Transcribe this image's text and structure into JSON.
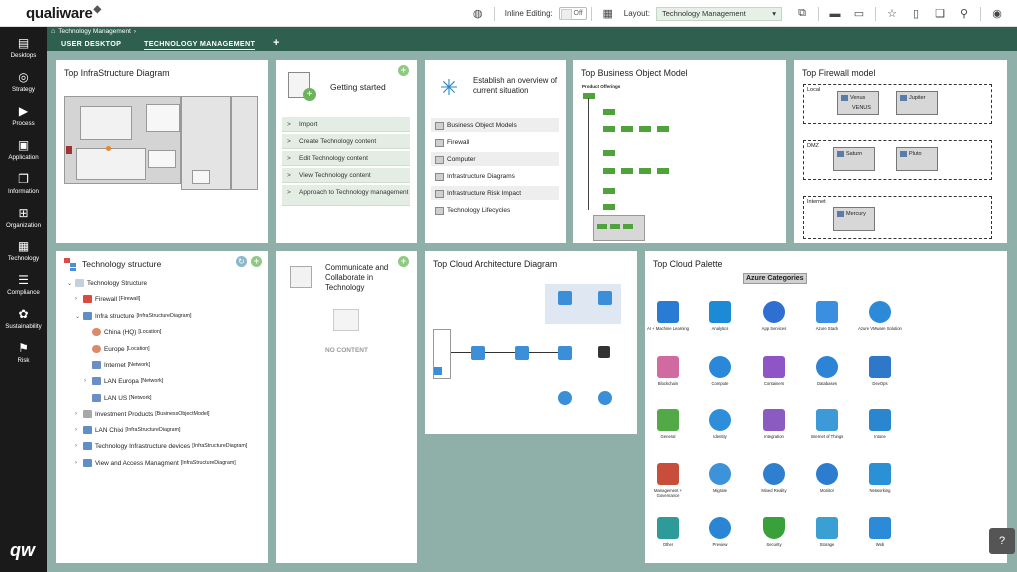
{
  "header": {
    "logo": "qualiware",
    "inline_editing_label": "Inline Editing:",
    "inline_editing_state": "Off",
    "layout_label": "Layout:",
    "layout_value": "Technology Management"
  },
  "sidebar": {
    "items": [
      {
        "label": "Desktops",
        "icon": "desktops-icon",
        "glyph": "▤"
      },
      {
        "label": "Strategy",
        "icon": "strategy-icon",
        "glyph": "◎"
      },
      {
        "label": "Process",
        "icon": "process-icon",
        "glyph": "▶"
      },
      {
        "label": "Application",
        "icon": "application-icon",
        "glyph": "▣"
      },
      {
        "label": "Information",
        "icon": "information-icon",
        "glyph": "❐"
      },
      {
        "label": "Organization",
        "icon": "organization-icon",
        "glyph": "⊞"
      },
      {
        "label": "Technology",
        "icon": "technology-icon",
        "glyph": "▦"
      },
      {
        "label": "Compliance",
        "icon": "compliance-icon",
        "glyph": "☰"
      },
      {
        "label": "Sustainability",
        "icon": "sustainability-icon",
        "glyph": "✿"
      },
      {
        "label": "Risk",
        "icon": "risk-icon",
        "glyph": "⚑"
      }
    ],
    "bottom_logo": "qw"
  },
  "tabs": {
    "breadcrumb": "Technology Management",
    "items": [
      {
        "label": "USER DESKTOP"
      },
      {
        "label": "TECHNOLOGY MANAGEMENT"
      }
    ]
  },
  "cards": {
    "infra": {
      "title": "Top InfraStructure Diagram"
    },
    "getting_started": {
      "title": "Getting started",
      "items": [
        "Import",
        "Create Technology content",
        "Edit Technology content",
        "View Technology content",
        "Approach to Technology management"
      ]
    },
    "overview": {
      "title": "Establish an overview of current situation",
      "items": [
        "Business Object Models",
        "Firewall",
        "Computer",
        "Infrastructure Diagrams",
        "Infrastructure Risk Impact",
        "Technology Lifecycles"
      ]
    },
    "business_object": {
      "title": "Top Business Object Model",
      "diagram_label": "Product Offerings"
    },
    "firewall": {
      "title": "Top Firewall model",
      "zones": [
        {
          "name": "Local",
          "boxes": [
            {
              "name": "Venus",
              "sub": "VENUS"
            },
            {
              "name": "Jupiter",
              "sub": ""
            }
          ]
        },
        {
          "name": "DMZ",
          "boxes": [
            {
              "name": "Saturn",
              "sub": ""
            },
            {
              "name": "Pluto",
              "sub": ""
            }
          ]
        },
        {
          "name": "Internet",
          "boxes": [
            {
              "name": "Mercury",
              "sub": ""
            }
          ]
        }
      ]
    },
    "tech_structure": {
      "title": "Technology structure",
      "tree": [
        {
          "label": "Technology Structure",
          "tag": "",
          "depth": 0,
          "arrow": "v"
        },
        {
          "label": "Firewall",
          "tag": "[Firewall]",
          "depth": 1,
          "arrow": ">"
        },
        {
          "label": "Infra structure",
          "tag": "[InfraStructureDiagram]",
          "depth": 1,
          "arrow": "v"
        },
        {
          "label": "China (HQ)",
          "tag": "[Location]",
          "depth": 2,
          "arrow": ""
        },
        {
          "label": "Europe",
          "tag": "[Location]",
          "depth": 2,
          "arrow": ""
        },
        {
          "label": "Internet",
          "tag": "[Network]",
          "depth": 2,
          "arrow": ""
        },
        {
          "label": "LAN Europa",
          "tag": "[Network]",
          "depth": 2,
          "arrow": ">"
        },
        {
          "label": "LAN US",
          "tag": "[Network]",
          "depth": 2,
          "arrow": ""
        },
        {
          "label": "Investment Products",
          "tag": "[BusinessObjectModel]",
          "depth": 1,
          "arrow": ">"
        },
        {
          "label": "LAN Chixi",
          "tag": "[InfraStructureDiagram]",
          "depth": 1,
          "arrow": ">"
        },
        {
          "label": "Technology Infrastructure devices",
          "tag": "[InfraStructureDiagram]",
          "depth": 1,
          "arrow": ">"
        },
        {
          "label": "View and Access Managment",
          "tag": "[InfraStructureDiagram]",
          "depth": 1,
          "arrow": ">"
        }
      ]
    },
    "communicate": {
      "title": "Communicate and Collaborate in Technology",
      "empty": "NO CONTENT"
    },
    "cloud_arch": {
      "title": "Top Cloud Architecture Diagram"
    },
    "cloud_palette": {
      "title": "Top Cloud Palette",
      "category_title": "Azure Categories",
      "items": [
        {
          "label": "AI + Machine Learning",
          "color": "#2a7bd4"
        },
        {
          "label": "Analytics",
          "color": "#1d8ad6"
        },
        {
          "label": "App Services",
          "color": "#2f6fd1"
        },
        {
          "label": "Azure Stack",
          "color": "#3a8fe0"
        },
        {
          "label": "Azure VMware Solution",
          "color": "#2b8bd8"
        },
        {
          "label": "Blockchain",
          "color": "#d16aa0"
        },
        {
          "label": "Compute",
          "color": "#2b88d8"
        },
        {
          "label": "Containers",
          "color": "#8f55c7"
        },
        {
          "label": "Databases",
          "color": "#2d83d6"
        },
        {
          "label": "DevOps",
          "color": "#2f77c9"
        },
        {
          "label": "General",
          "color": "#53a848"
        },
        {
          "label": "Identity",
          "color": "#2f8ed9"
        },
        {
          "label": "Integration",
          "color": "#8b5bc2"
        },
        {
          "label": "Internet of Things",
          "color": "#3c9ad8"
        },
        {
          "label": "Intune",
          "color": "#2a87cf"
        },
        {
          "label": "Management + Governance",
          "color": "#c94d3b"
        },
        {
          "label": "Migrate",
          "color": "#3d93d9"
        },
        {
          "label": "Mixed Reality",
          "color": "#2f7fd0"
        },
        {
          "label": "Monitor",
          "color": "#2c7cd0"
        },
        {
          "label": "Networking",
          "color": "#2b91d6"
        },
        {
          "label": "Other",
          "color": "#2f9a9a"
        },
        {
          "label": "Preview",
          "color": "#2a85d4"
        },
        {
          "label": "Security",
          "color": "#3aa13a"
        },
        {
          "label": "Storage",
          "color": "#3aa0d4"
        },
        {
          "label": "Web",
          "color": "#2b8bd8"
        }
      ]
    }
  },
  "colors": {
    "accent": "#2e5f4f",
    "background": "#8fb0a8",
    "sidebar": "#1a1a1a"
  }
}
